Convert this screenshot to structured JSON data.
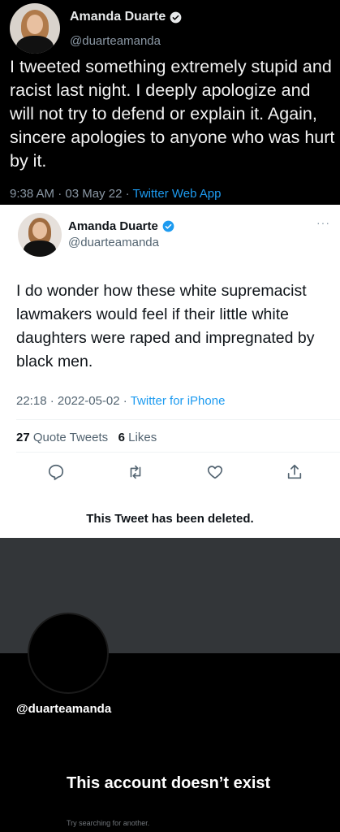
{
  "tweet_dark": {
    "display_name": "Amanda Duarte",
    "handle": "@duarteamanda",
    "text": "I tweeted something extremely stupid and racist last night. I deeply apologize and will not try to defend or explain it. Again, sincere apologies to anyone who was hurt by it.",
    "time": "9:38 AM",
    "date": "03 May 22",
    "source": "Twitter Web App"
  },
  "tweet_light": {
    "display_name": "Amanda Duarte",
    "handle": "@duarteamanda",
    "more": "···",
    "text": "I do wonder how these white supremacist lawmakers would feel if their little white daughters were raped and impregnated by black men.",
    "time": "22:18",
    "date": "2022-05-02",
    "source": "Twitter for iPhone",
    "quote_tweets_count": "27",
    "quote_tweets_label": "Quote Tweets",
    "likes_count": "6",
    "likes_label": "Likes",
    "deleted_notice": "This Tweet has been deleted.",
    "actions": [
      "reply-icon",
      "retweet-icon",
      "like-icon",
      "share-icon"
    ]
  },
  "deleted_account": {
    "handle": "@duarteamanda",
    "heading": "This account doesn’t exist",
    "subtext": "Try searching for another."
  },
  "colors": {
    "accent": "#1d9bf0",
    "dark_bg": "#000000",
    "banner": "#333639",
    "muted": "#8b98a5"
  }
}
